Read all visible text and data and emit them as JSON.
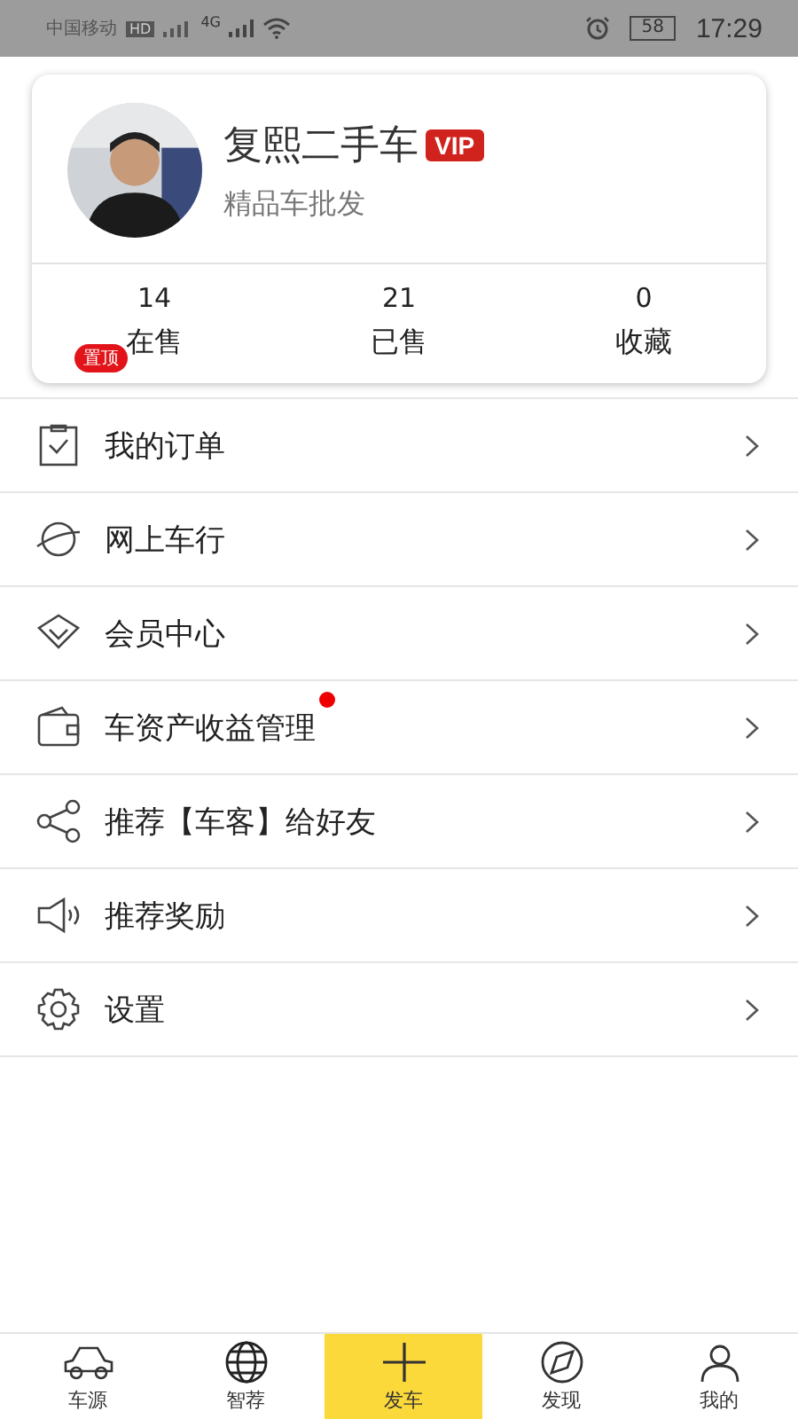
{
  "status_bar": {
    "carrier": "中国移动",
    "hd": "HD",
    "network": "4G",
    "battery": "58",
    "time": "17:29"
  },
  "profile": {
    "name": "复熙二手车",
    "vip": "VIP",
    "subtitle": "精品车批发",
    "stats": [
      {
        "value": "14",
        "label": "在售",
        "badge": "置顶"
      },
      {
        "value": "21",
        "label": "已售"
      },
      {
        "value": "0",
        "label": "收藏"
      }
    ]
  },
  "menu": [
    {
      "label": "我的订单",
      "dot": false
    },
    {
      "label": "网上车行",
      "dot": false
    },
    {
      "label": "会员中心",
      "dot": false
    },
    {
      "label": "车资产收益管理",
      "dot": true
    },
    {
      "label": "推荐【车客】给好友",
      "dot": false
    },
    {
      "label": "推荐奖励",
      "dot": false
    },
    {
      "label": "设置",
      "dot": false
    }
  ],
  "tabs": [
    {
      "label": "车源",
      "selected": false
    },
    {
      "label": "智荐",
      "selected": false
    },
    {
      "label": "发车",
      "selected": true
    },
    {
      "label": "发现",
      "selected": false
    },
    {
      "label": "我的",
      "selected": false
    }
  ]
}
